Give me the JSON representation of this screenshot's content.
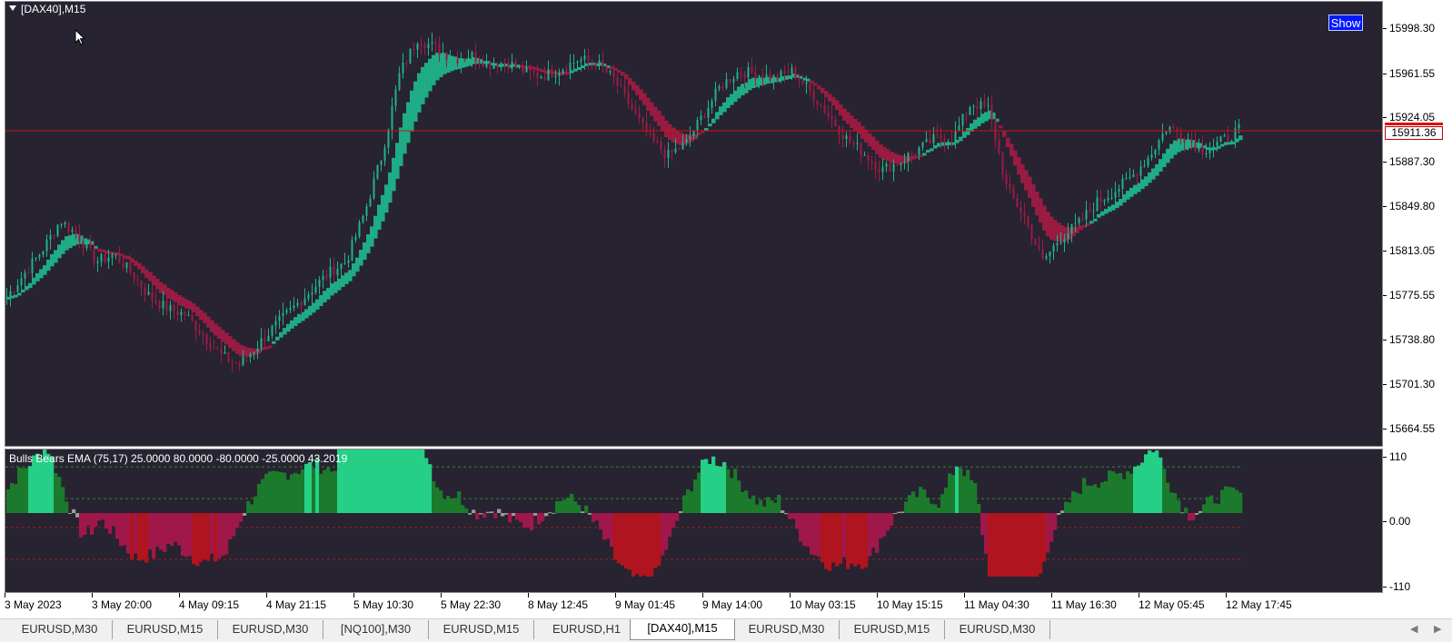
{
  "chart": {
    "title": "[DAX40],M15",
    "show_button": "Show",
    "current_price": "15911.36",
    "price_axis": [
      "15998.30",
      "15961.55",
      "15924.05",
      "15887.30",
      "15849.80",
      "15813.05",
      "15775.55",
      "15738.80",
      "15701.30",
      "15664.55"
    ],
    "time_axis": [
      "3 May 2023",
      "3 May 20:00",
      "4 May 09:15",
      "4 May 21:15",
      "5 May 10:30",
      "5 May 22:30",
      "8 May 12:45",
      "9 May 01:45",
      "9 May 14:00",
      "10 May 03:15",
      "10 May 15:15",
      "11 May 04:30",
      "11 May 16:30",
      "12 May 05:45",
      "12 May 17:45"
    ],
    "colors": {
      "background": "#272331",
      "bull_candle": "#1fb389",
      "bear_candle": "#9e1b43",
      "ribbon_up": "#1fb389",
      "ribbon_down": "#9e1b43",
      "price_line": "#d01010",
      "show_button": "#0018ff"
    }
  },
  "indicator": {
    "title": "Bulls Bears EMA (75,17) 25.0000 80.0000 -80.0000 -25.0000 43.2019",
    "axis": [
      "110",
      "0.00",
      "-110"
    ],
    "levels": [
      80,
      25,
      -25,
      -80
    ],
    "colors": {
      "strong_bull": "#25cf86",
      "bull": "#1b7a2b",
      "bear": "#a0174a",
      "strong_bear": "#b0141e",
      "neutral": "#9a9a9a"
    }
  },
  "chart_data": {
    "type": "line",
    "title": "",
    "series": [
      {
        "name": "",
        "values": [
          15770,
          15790,
          15810,
          15835,
          15822,
          15800,
          15806,
          15790,
          15770,
          15760,
          15755,
          15738,
          15720,
          15712,
          15728,
          15745,
          15760,
          15775,
          15790,
          15800,
          15840,
          15890,
          15960,
          15990,
          15982,
          15972,
          15976,
          15968,
          15970,
          15962,
          15958,
          15964,
          15972,
          15970,
          15955,
          15930,
          15905,
          15890,
          15900,
          15925,
          15950,
          15962,
          15960,
          15956,
          15962,
          15945,
          15925,
          15905,
          15892,
          15878,
          15885,
          15895,
          15905,
          15905,
          15935,
          15930,
          15862,
          15838,
          15800,
          15820,
          15832,
          15850,
          15860,
          15872,
          15890,
          15915,
          15906,
          15895,
          15902,
          15912
        ]
      }
    ],
    "ylim": [
      15650,
      16015
    ]
  },
  "tabs": [
    {
      "label": "EURUSD,M30",
      "active": false
    },
    {
      "label": "EURUSD,M15",
      "active": false
    },
    {
      "label": "EURUSD,M30",
      "active": false
    },
    {
      "label": "[NQ100],M30",
      "active": false
    },
    {
      "label": "EURUSD,M15",
      "active": false
    },
    {
      "label": "EURUSD,H1",
      "active": false
    },
    {
      "label": "[DAX40],M15",
      "active": true
    },
    {
      "label": "EURUSD,M30",
      "active": false
    },
    {
      "label": "EURUSD,M15",
      "active": false
    },
    {
      "label": "EURUSD,M30",
      "active": false
    }
  ],
  "icons": {
    "collapse": "triangle-down-icon",
    "cursor": "mouse-pointer-icon",
    "scroll_left": "arrow-left-icon",
    "scroll_right": "arrow-right-icon"
  }
}
